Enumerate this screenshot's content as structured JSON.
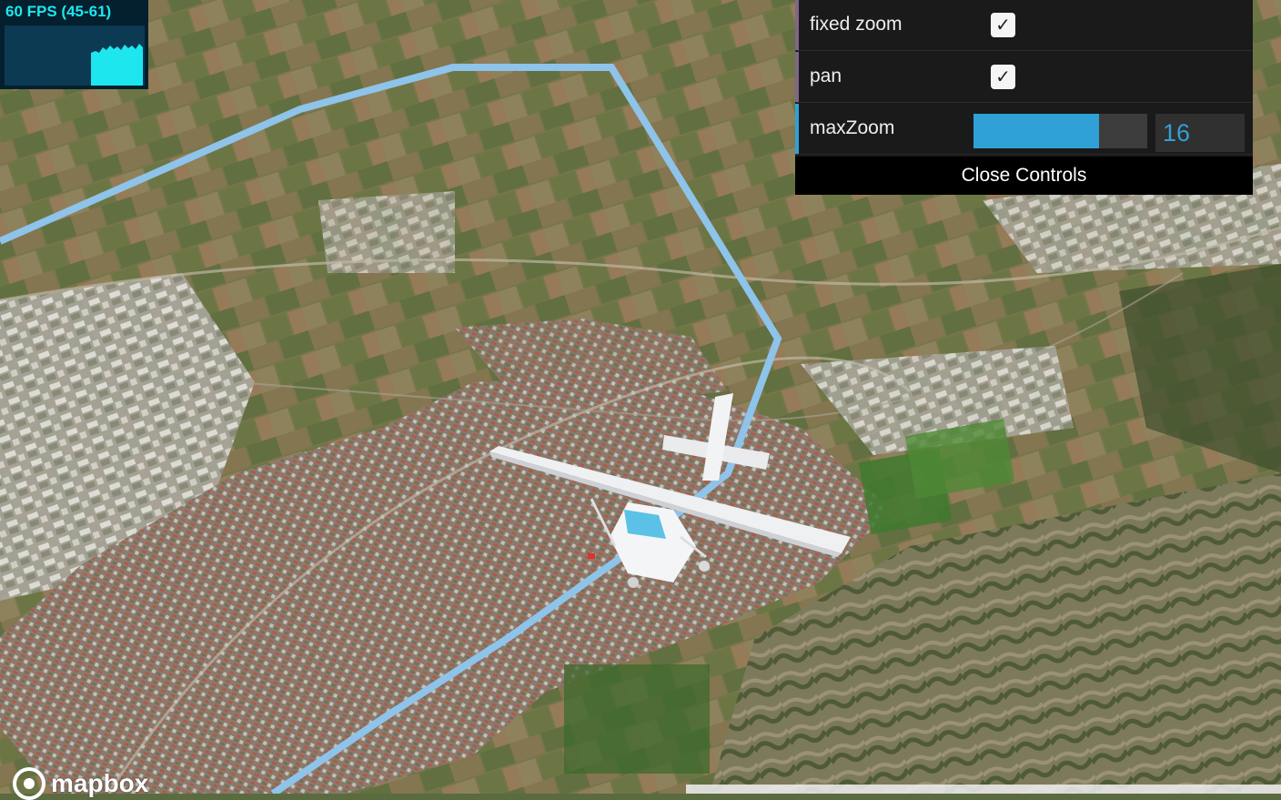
{
  "fps": {
    "label": "60 FPS (45-61)",
    "current": 60,
    "min": 45,
    "max": 61,
    "text_color": "#1ee6ee",
    "background": "#041f2d"
  },
  "controls": {
    "fixed_zoom": {
      "label": "fixed zoom",
      "checked": true
    },
    "pan": {
      "label": "pan",
      "checked": true
    },
    "max_zoom": {
      "label": "maxZoom",
      "value": "16",
      "slider_fraction": 0.72
    },
    "close_label": "Close Controls",
    "accent_color": "#2fa1d6",
    "checkbox_accent": "#806787"
  },
  "map": {
    "attribution": "mapbox",
    "route_color": "#8ec3ea",
    "aircraft_icon": "airplane-icon"
  }
}
